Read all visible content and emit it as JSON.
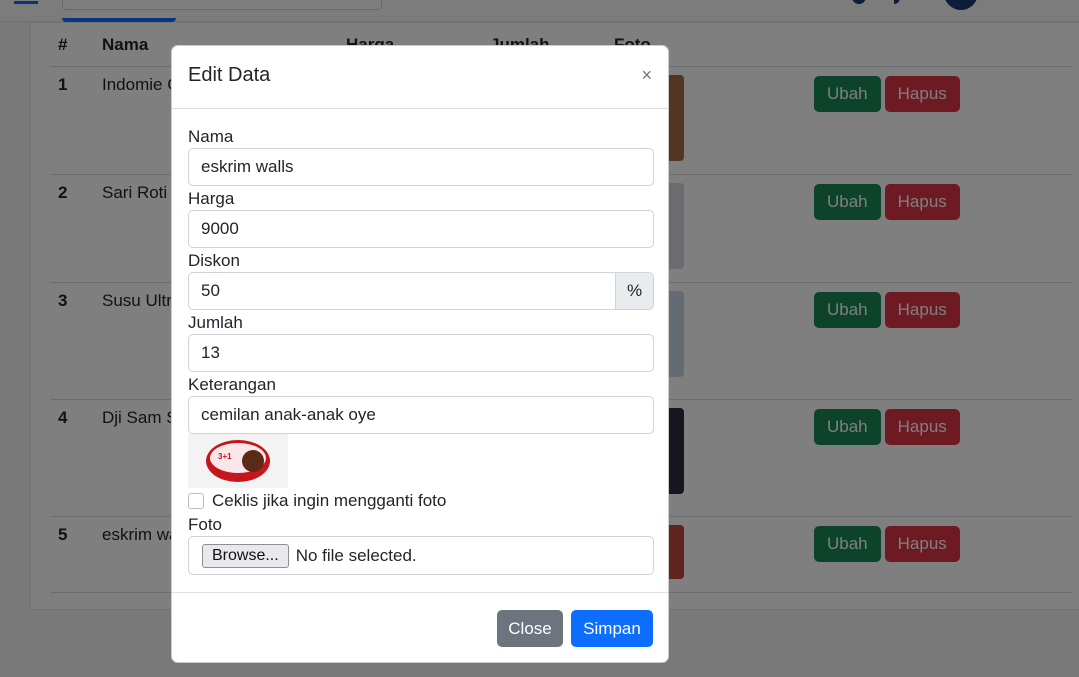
{
  "table": {
    "headers": [
      "#",
      "Nama",
      "Harga",
      "Jumlah",
      "Foto"
    ],
    "rows": [
      {
        "num": "1",
        "name": "Indomie G",
        "ubah": "Ubah",
        "hapus": "Hapus"
      },
      {
        "num": "2",
        "name": "Sari Roti I",
        "ubah": "Ubah",
        "hapus": "Hapus"
      },
      {
        "num": "3",
        "name": "Susu Ultr",
        "ubah": "Ubah",
        "hapus": "Hapus"
      },
      {
        "num": "4",
        "name": "Dji Sam S",
        "ubah": "Ubah",
        "hapus": "Hapus"
      },
      {
        "num": "5",
        "name": "eskrim wa",
        "ubah": "Ubah",
        "hapus": "Hapus"
      }
    ]
  },
  "modal": {
    "title": "Edit Data",
    "close_icon": "×",
    "fields": {
      "nama": {
        "label": "Nama",
        "value": "eskrim walls"
      },
      "harga": {
        "label": "Harga",
        "value": "9000"
      },
      "diskon": {
        "label": "Diskon",
        "value": "50",
        "suffix": "%"
      },
      "jumlah": {
        "label": "Jumlah",
        "value": "13"
      },
      "keterangan": {
        "label": "Keterangan",
        "value": "cemilan anak-anak oye"
      }
    },
    "preview_text": "3+1",
    "checkbox_label": "Ceklis jika ingin mengganti foto",
    "foto": {
      "label": "Foto",
      "browse_label": "Browse...",
      "file_status": "No file selected."
    },
    "buttons": {
      "close": "Close",
      "save": "Simpan"
    }
  },
  "colors": {
    "primary": "#0d6efd",
    "success": "#198754",
    "danger": "#dc3545",
    "secondary": "#6c757d"
  }
}
